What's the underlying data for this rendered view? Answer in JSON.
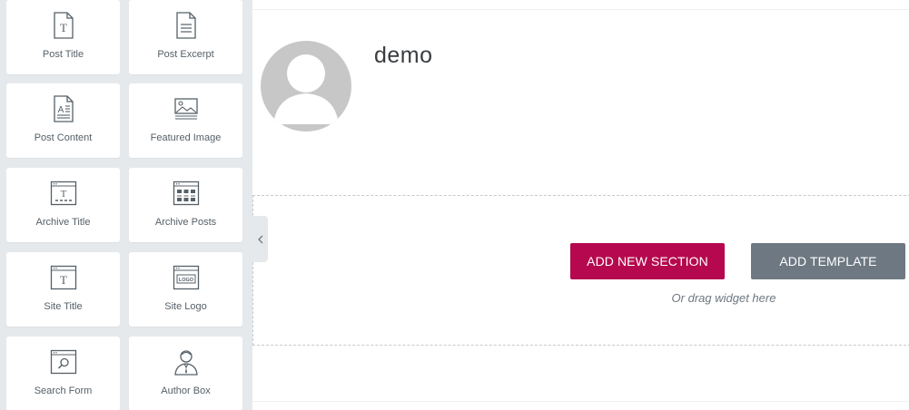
{
  "panel": {
    "widgets": [
      {
        "label": "Post Title",
        "icon": "post-title-icon"
      },
      {
        "label": "Post Excerpt",
        "icon": "post-excerpt-icon"
      },
      {
        "label": "Post Content",
        "icon": "post-content-icon"
      },
      {
        "label": "Featured Image",
        "icon": "featured-image-icon"
      },
      {
        "label": "Archive Title",
        "icon": "archive-title-icon"
      },
      {
        "label": "Archive Posts",
        "icon": "archive-posts-icon"
      },
      {
        "label": "Site Title",
        "icon": "site-title-icon"
      },
      {
        "label": "Site Logo",
        "icon": "site-logo-icon"
      },
      {
        "label": "Search Form",
        "icon": "search-form-icon"
      },
      {
        "label": "Author Box",
        "icon": "author-box-icon"
      }
    ]
  },
  "canvas": {
    "post_title": "demo",
    "add_section_label": "ADD NEW SECTION",
    "add_template_label": "ADD TEMPLATE",
    "drag_hint": "Or drag widget here"
  },
  "colors": {
    "panel_bg": "#e6e9ec",
    "primary_button": "#b5084e",
    "secondary_button": "#6d7882",
    "avatar_placeholder": "#c7c7c7"
  }
}
